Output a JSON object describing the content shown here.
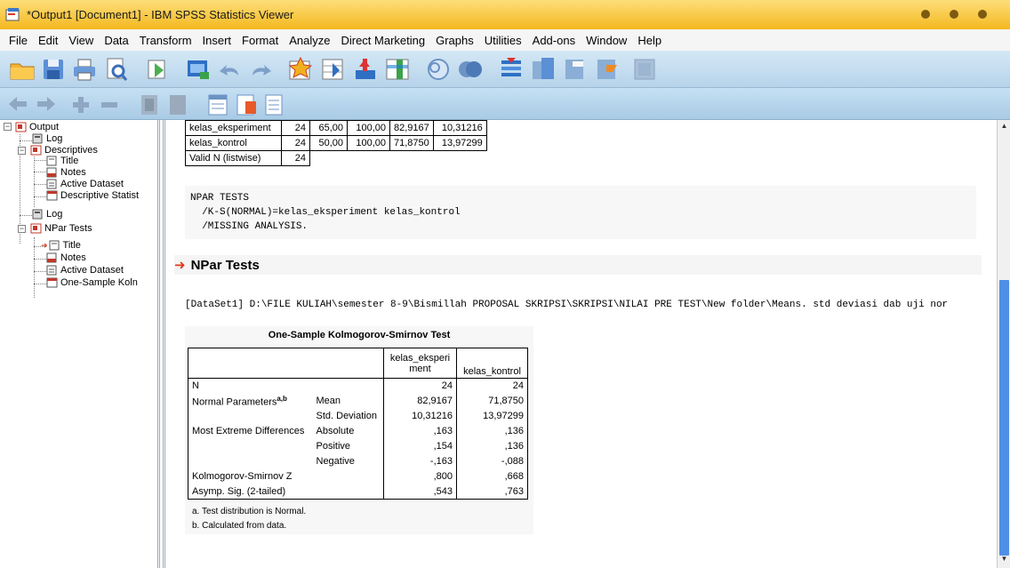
{
  "window": {
    "title": "*Output1 [Document1] - IBM SPSS Statistics Viewer"
  },
  "menu": [
    "File",
    "Edit",
    "View",
    "Data",
    "Transform",
    "Insert",
    "Format",
    "Analyze",
    "Direct Marketing",
    "Graphs",
    "Utilities",
    "Add-ons",
    "Window",
    "Help"
  ],
  "toolbar1_icons": [
    "open-folder-icon",
    "save-icon",
    "print-icon",
    "print-preview-icon",
    "export-icon",
    "recall-dialog-icon",
    "undo-icon",
    "redo-icon",
    "goto-data-icon",
    "goto-variable-icon",
    "variables-icon",
    "select-cases-icon",
    "use-sets-icon",
    "show-all-variables-icon",
    "spell-check-icon",
    "designate-window-icon",
    "insert-heading-icon",
    "insert-title-icon",
    "insert-text-icon",
    "insert-output-icon"
  ],
  "toolbar2_icons": [
    "back-icon",
    "forward-icon",
    "expand-icon",
    "collapse-icon",
    "show-icon",
    "hide-icon",
    "insert-heading-icon",
    "insert-title-icon",
    "insert-text-icon"
  ],
  "outline": {
    "items": [
      {
        "label": "Output",
        "icon": "output-book-icon"
      },
      {
        "label": "Log",
        "icon": "log-icon"
      },
      {
        "label": "Descriptives",
        "icon": "procedure-book-icon"
      },
      {
        "label": "Title",
        "icon": "title-icon"
      },
      {
        "label": "Notes",
        "icon": "notes-icon"
      },
      {
        "label": "Active Dataset",
        "icon": "dataset-icon"
      },
      {
        "label": "Descriptive Statist",
        "icon": "table-icon"
      },
      {
        "label": "Log",
        "icon": "log-icon"
      },
      {
        "label": "NPar Tests",
        "icon": "procedure-book-icon"
      },
      {
        "label": "Title",
        "icon": "title-icon"
      },
      {
        "label": "Notes",
        "icon": "notes-icon"
      },
      {
        "label": "Active Dataset",
        "icon": "dataset-icon"
      },
      {
        "label": "One-Sample Koln",
        "icon": "table-icon"
      }
    ]
  },
  "descriptives_table": {
    "rows": [
      [
        "kelas_eksperiment",
        "24",
        "65,00",
        "100,00",
        "82,9167",
        "10,31216"
      ],
      [
        "kelas_kontrol",
        "24",
        "50,00",
        "100,00",
        "71,8750",
        "13,97299"
      ],
      [
        "Valid N (listwise)",
        "24",
        "",
        "",
        "",
        ""
      ]
    ]
  },
  "syntax": {
    "line1": "NPAR TESTS",
    "line2": "  /K-S(NORMAL)=kelas_eksperiment kelas_kontrol",
    "line3": "  /MISSING ANALYSIS."
  },
  "npar_heading": "NPar Tests",
  "dataset_line": "[DataSet1] D:\\FILE KULIAH\\semester 8-9\\Bismillah PROPOSAL SKRIPSI\\SKRIPSI\\NILAI PRE TEST\\New folder\\Means. std deviasi dab uji nor",
  "ks": {
    "title": "One-Sample Kolmogorov-Smirnov Test",
    "col1": "kelas_eksperi",
    "col1b": "ment",
    "col2": "kelas_kontrol",
    "rows": [
      {
        "a": "N",
        "b": "",
        "v1": "24",
        "v2": "24"
      },
      {
        "a": "Normal Parameters",
        "sup": "a,b",
        "b": "Mean",
        "v1": "82,9167",
        "v2": "71,8750"
      },
      {
        "a": "",
        "b": "Std. Deviation",
        "v1": "10,31216",
        "v2": "13,97299"
      },
      {
        "a": "Most Extreme Differences",
        "b": "Absolute",
        "v1": ",163",
        "v2": ",136"
      },
      {
        "a": "",
        "b": "Positive",
        "v1": ",154",
        "v2": ",136"
      },
      {
        "a": "",
        "b": "Negative",
        "v1": "-,163",
        "v2": "-,088"
      },
      {
        "a": "Kolmogorov-Smirnov Z",
        "b": "",
        "v1": ",800",
        "v2": ",668"
      },
      {
        "a": "Asymp. Sig. (2-tailed)",
        "b": "",
        "v1": ",543",
        "v2": ",763"
      }
    ],
    "foot_a": "a. Test distribution is Normal.",
    "foot_b": "b. Calculated from data."
  }
}
